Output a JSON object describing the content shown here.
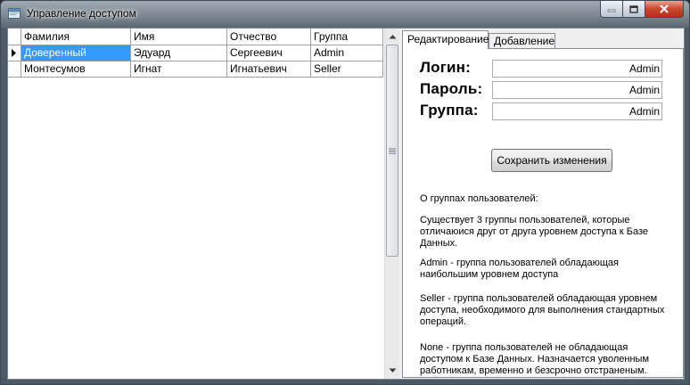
{
  "window": {
    "title": "Управление доступом"
  },
  "grid": {
    "columns": [
      "Фамилия",
      "Имя",
      "Отчество",
      "Группа"
    ],
    "rows": [
      {
        "cells": [
          "Доверенный",
          "Эдуард",
          "Сергеевич",
          "Admin"
        ]
      },
      {
        "cells": [
          "Монтесумов",
          "Игнат",
          "Игнатьевич",
          "Seller"
        ]
      }
    ]
  },
  "tabs": [
    "Редактирование",
    "Добавление"
  ],
  "form": {
    "login_label": "Логин:",
    "login_value": "Admin",
    "password_label": "Пароль:",
    "password_value": "Admin",
    "group_label": "Группа:",
    "group_value": "Admin",
    "save_button": "Сохранить изменения"
  },
  "info": {
    "heading": "О группах пользователей:",
    "p1": "Существует 3 группы пользователей, которые отличаюися друг от друга уровнем доступа к Базе Данных.",
    "p2": "Admin - группа пользователей обладающая наибольшим уровнем доступа",
    "p3": "Seller - группа пользователей обладающая уровнем доступа, необходимого для выполнения стандартных операций.",
    "p4": "None - группа пользователей не обладающая доступом к Базе Данных. Назначается уволенным работникам, временно и безсрочно отстраненым."
  },
  "icons": {
    "app": "app-window-icon",
    "minimize": "minimize-icon",
    "maximize": "maximize-icon",
    "close": "close-icon",
    "row_pointer": "row-pointer-icon",
    "scroll_up": "scroll-up-arrow-icon",
    "scroll_down": "scroll-down-arrow-icon",
    "scroll_grip": "scroll-grip-icon"
  },
  "colors": {
    "selection": "#3399ff",
    "close_button": "#c9452c"
  }
}
